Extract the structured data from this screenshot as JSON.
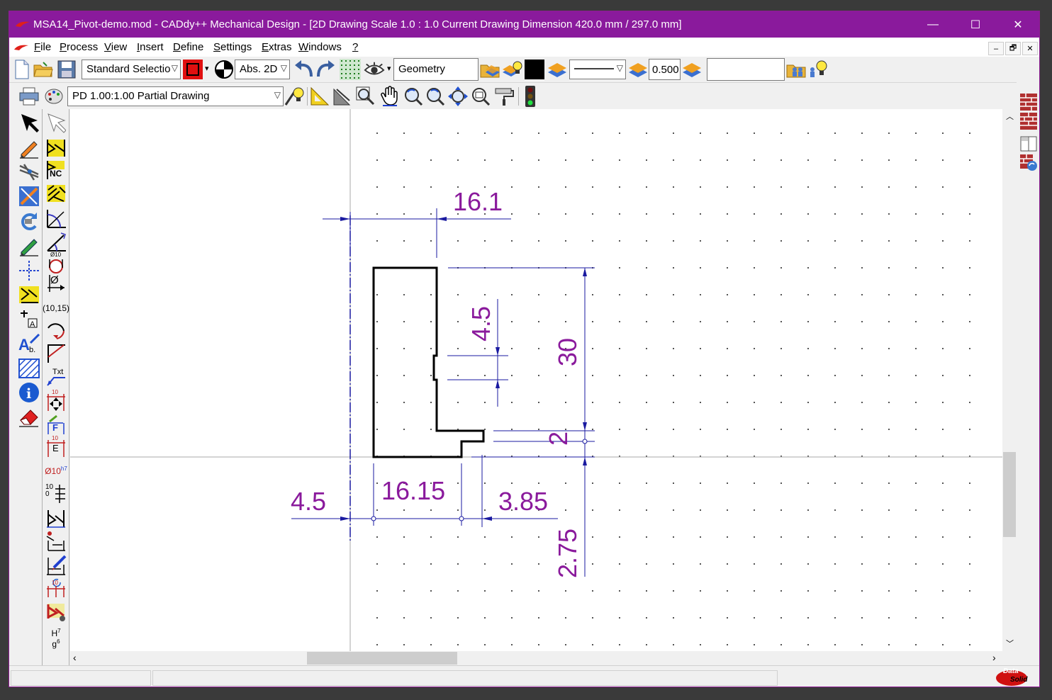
{
  "window": {
    "title": "MSA14_Pivot-demo.mod  -  CADdy++ Mechanical Design - [2D Drawing   Scale 1.0 : 1.0   Current Drawing Dimension 420.0 mm / 297.0 mm]",
    "minimize": "—",
    "maximize": "☐",
    "close": "✕"
  },
  "menu": [
    "File",
    "Process",
    "View",
    "Insert",
    "Define",
    "Settings",
    "Extras",
    "Windows",
    "?"
  ],
  "menu_underline": [
    "F",
    "P",
    "V",
    "I",
    "D",
    "S",
    "E",
    "W",
    "?"
  ],
  "menu_rest": [
    "ile",
    "rocess",
    "iew",
    "nsert",
    "efine",
    "ettings",
    "xtras",
    "indows",
    ""
  ],
  "mdi_buttons": [
    "–",
    "🗗",
    "✕"
  ],
  "toolbar": {
    "selection_mode": "Standard Selectio",
    "coord_mode": "Abs. 2D",
    "layer": "Geometry",
    "line_width": "0.500",
    "search_value": ""
  },
  "toolbar2": {
    "drawing_select": "PD 1.00:1.00 Partial Drawing"
  },
  "left_labels": {
    "coord": "(10,15)",
    "txt": "Txt",
    "nc": "NC",
    "dia": "Ø10",
    "dia_h7": "Ø10",
    "h7_sup": "h7",
    "fit_h": "H",
    "fit_h_sup": "7",
    "fit_g": "g",
    "fit_g_sup": "6",
    "e_label": "E",
    "f_label": "F",
    "ten": "10",
    "zero": "0"
  },
  "drawing": {
    "dimensions": {
      "top_width": "16.1",
      "slot": "4.5",
      "height": "30",
      "step": "2",
      "bottom_left": "4.5",
      "bottom_mid": "16.15",
      "bottom_right": "3.85",
      "bottom_vertical": "2.75"
    }
  },
  "status": {
    "left": "",
    "middle": "",
    "brand_line1": "Data",
    "brand_line2": "Solid"
  },
  "colors": {
    "titlebar": "#8a1a9c",
    "dimension_text": "#8a1a9c",
    "dimension_lines": "#1a1aa0",
    "geometry": "#000000"
  }
}
